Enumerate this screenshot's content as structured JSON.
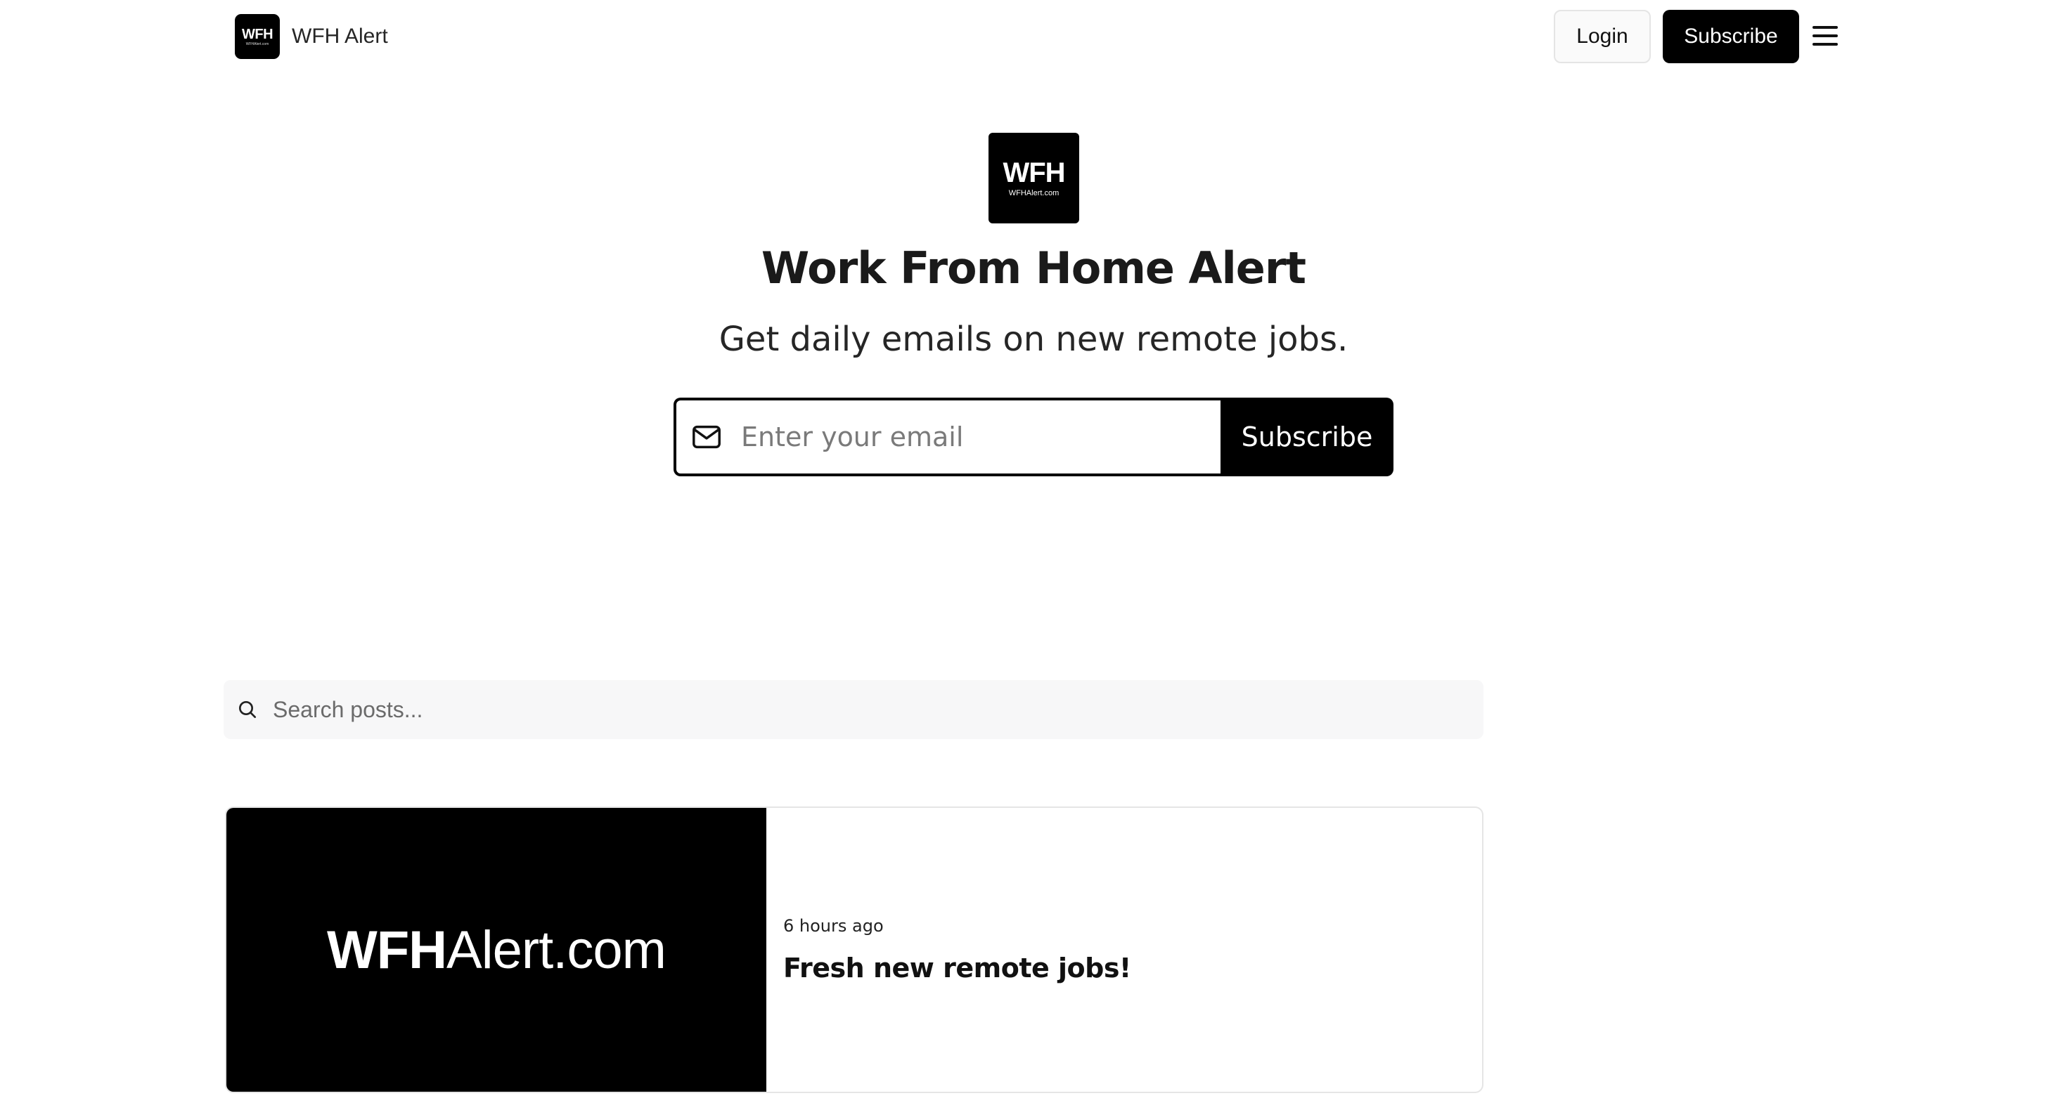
{
  "header": {
    "brand_name": "WFH Alert",
    "logo_mark": "WFH",
    "logo_sub": "WFHAlert.com",
    "login_label": "Login",
    "subscribe_label": "Subscribe",
    "menu_icon": "hamburger-menu-icon"
  },
  "hero": {
    "logo_mark": "WFH",
    "logo_sub": "WFHAlert.com",
    "title": "Work From Home Alert",
    "subtitle": "Get daily emails on new remote jobs.",
    "email_placeholder": "Enter your email",
    "email_icon": "mail-icon",
    "subscribe_label": "Subscribe"
  },
  "search": {
    "placeholder": "Search posts...",
    "icon": "search-icon"
  },
  "posts": [
    {
      "thumb_bold": "WFH",
      "thumb_rest": "Alert.com",
      "time": "6 hours ago",
      "title": "Fresh new remote jobs!"
    }
  ],
  "colors": {
    "brand": "#000000",
    "background": "#ffffff",
    "search_bg": "#f7f7f8",
    "border": "#e5e5e5"
  }
}
